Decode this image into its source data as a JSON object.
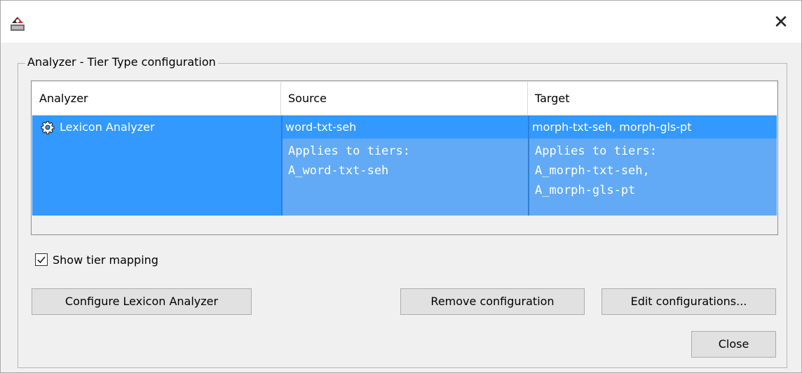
{
  "window": {
    "app_icon": "elan-app-icon",
    "close_glyph": "✕"
  },
  "group": {
    "title": "Analyzer - Tier Type configuration"
  },
  "table": {
    "columns": [
      "Analyzer",
      "Source",
      "Target"
    ],
    "rows": [
      {
        "analyzer_icon": "gear-icon",
        "analyzer": "Lexicon Analyzer",
        "source": "word-txt-seh",
        "target": "morph-txt-seh, morph-gls-pt",
        "source_tiers": [
          "Applies to tiers:",
          "A_word-txt-seh"
        ],
        "target_tiers": [
          "Applies to tiers:",
          "A_morph-txt-seh,",
          "A_morph-gls-pt"
        ]
      }
    ],
    "selection_color": "#3399ff",
    "tier_box_color": "#62aaf5"
  },
  "options": {
    "show_tier_mapping_label": "Show tier mapping",
    "show_tier_mapping_checked": true
  },
  "buttons": {
    "configure": "Configure Lexicon Analyzer",
    "remove": "Remove configuration",
    "edit": "Edit configurations...",
    "close": "Close"
  }
}
